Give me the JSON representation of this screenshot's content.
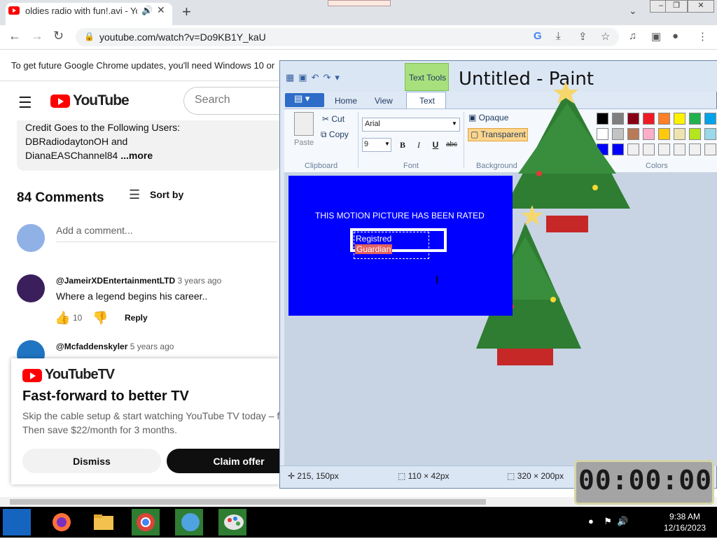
{
  "browser": {
    "tab_title": "oldies radio with fun!.avi - Yo",
    "url": "youtube.com/watch?v=Do9KB1Y_kaU",
    "update_notice": "To get future Google Chrome updates, you'll need Windows 10 or l"
  },
  "youtube": {
    "logo_text": "YouTube",
    "search_placeholder": "Search",
    "description": {
      "line1": "Credit Goes to the Following Users:",
      "line2": "DBRadiodaytonOH and",
      "line3": "DianaEASChannel84",
      "more": "...more"
    },
    "comments_count": "84 Comments",
    "sort_label": "Sort by",
    "add_comment_placeholder": "Add a comment...",
    "comments": [
      {
        "author": "@JameirXDEntertainmentLTD",
        "age": "3 years ago",
        "text": "Where a legend begins his career..",
        "likes": "10",
        "reply": "Reply"
      },
      {
        "author": "@Mcfaddenskyler",
        "age": "5 years ago"
      }
    ],
    "promo": {
      "logo_text": "YouTubeTV",
      "heading": "Fast-forward to better TV",
      "line1": "Skip the cable setup & start watching YouTube TV today – f",
      "line2": "Then save $22/month for 3 months.",
      "dismiss": "Dismiss",
      "claim": "Claim offer"
    }
  },
  "paint": {
    "title": "Untitled - Paint",
    "contextual_tab": "Text Tools",
    "tabs": [
      "Home",
      "View",
      "Text"
    ],
    "clipboard": {
      "paste": "Paste",
      "cut": "Cut",
      "copy": "Copy",
      "group": "Clipboard"
    },
    "font": {
      "name": "Arial",
      "size": "9",
      "group": "Font",
      "bold": "B",
      "italic": "I",
      "underline": "U",
      "strike": "abc"
    },
    "background": {
      "opaque": "Opaque",
      "transparent": "Transparent",
      "group": "Background"
    },
    "colors_group": "Colors",
    "palette": [
      "#000000",
      "#7f7f7f",
      "#880015",
      "#ed1c24",
      "#ff7f27",
      "#fff200",
      "#22b14c",
      "#00a2e8",
      "#ffffff",
      "#c3c3c3",
      "#b97a57",
      "#ffaec9",
      "#ffc90e",
      "#efe4b0",
      "#b5e61d",
      "#99d9ea",
      "#0000ff",
      "#0000ff",
      "#f0f0f0",
      "#f0f0f0",
      "#f0f0f0",
      "#f0f0f0",
      "#f0f0f0",
      "#f0f0f0"
    ],
    "canvas": {
      "rated_text": "THIS MOTION PICTURE HAS BEEN RATED",
      "textbox_line1": "Registred",
      "textbox_line2": "Guardian"
    },
    "status": {
      "cursor": "215, 150px",
      "selection": "110 × 42px",
      "canvas_size": "320 × 200px"
    }
  },
  "timer": "00:00:00",
  "taskbar": {
    "time": "9:38 AM",
    "date": "12/16/2023"
  },
  "colors": {
    "youtube_red": "#ff0000",
    "canvas_blue": "#0000ff",
    "texttools_green": "#a9e07e"
  }
}
